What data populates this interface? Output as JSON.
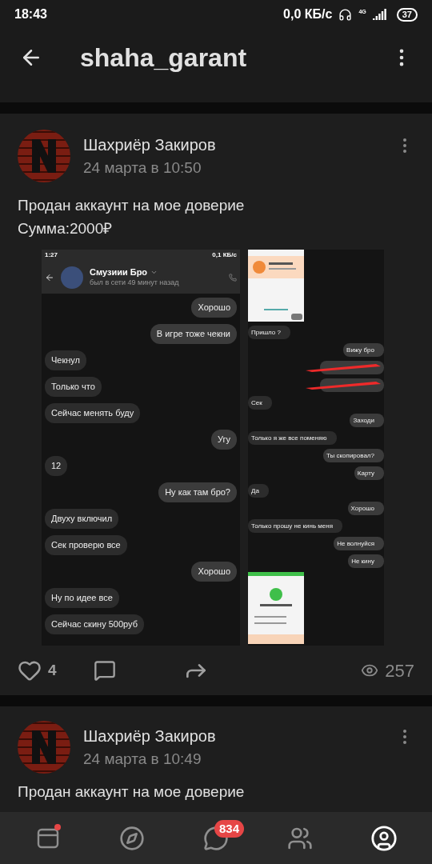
{
  "status_bar": {
    "time": "18:43",
    "speed": "0,0 КБ/с",
    "network": "4G",
    "battery": "37"
  },
  "header": {
    "title": "shaha_garant"
  },
  "posts": [
    {
      "author": "Шахриёр Закиров",
      "date": "24 марта в 10:50",
      "text": "Продан аккаунт на мое доверие\nСумма:2000₽",
      "left_chat": {
        "time": "1:27",
        "speed": "0,1 КБ/с",
        "contact": "Смузиии Бро",
        "status": "был в сети 49 минут назад",
        "messages": [
          {
            "text": "Хорошо",
            "outgoing": true
          },
          {
            "text": "В игре тоже чекни",
            "outgoing": true
          },
          {
            "text": "Чекнул",
            "outgoing": false
          },
          {
            "text": "Только что",
            "outgoing": false
          },
          {
            "text": "Сейчас менять буду",
            "outgoing": false
          },
          {
            "text": "Угу",
            "outgoing": true
          },
          {
            "text": "12",
            "outgoing": false
          },
          {
            "text": "Ну как там бро?",
            "outgoing": true
          },
          {
            "text": "Двуху включил",
            "outgoing": false
          },
          {
            "text": "Сек проверю все",
            "outgoing": false
          },
          {
            "text": "Хорошо",
            "outgoing": true
          },
          {
            "text": "Ну по идее все",
            "outgoing": false
          },
          {
            "text": "Сейчас скину 500руб",
            "outgoing": false
          }
        ]
      },
      "right_chat": {
        "items": [
          {
            "kind": "picture"
          },
          {
            "kind": "text",
            "text": "Пришло ?",
            "outgoing": false
          },
          {
            "kind": "text",
            "text": "Вижу бро",
            "outgoing": true
          },
          {
            "kind": "redacted",
            "outgoing": true
          },
          {
            "kind": "redacted",
            "outgoing": true
          },
          {
            "kind": "text",
            "text": "Сек",
            "outgoing": false
          },
          {
            "kind": "text",
            "text": "Заходи",
            "outgoing": true
          },
          {
            "kind": "text",
            "text": "Только я же все поменяю",
            "outgoing": false
          },
          {
            "kind": "text",
            "text": "Ты скопировал?",
            "outgoing": true
          },
          {
            "kind": "text",
            "text": "Карту",
            "outgoing": true
          },
          {
            "kind": "text",
            "text": "Да",
            "outgoing": false
          },
          {
            "kind": "text",
            "text": "Хорошо",
            "outgoing": true
          },
          {
            "kind": "text",
            "text": "Только прошу не кинь меня",
            "outgoing": false
          },
          {
            "kind": "text",
            "text": "Не волнуйся",
            "outgoing": true
          },
          {
            "kind": "text",
            "text": "Не кину",
            "outgoing": true
          },
          {
            "kind": "picture"
          }
        ]
      },
      "likes": "4",
      "liked": false,
      "views": "257"
    },
    {
      "author": "Шахриёр Закиров",
      "date": "24 марта в 10:49",
      "text": "Продан аккаунт на мое доверие"
    }
  ],
  "nav": [
    {
      "kind": "feed",
      "selected": false,
      "dot": true
    },
    {
      "kind": "explore",
      "selected": false,
      "dot": false
    },
    {
      "kind": "messages",
      "selected": false,
      "dot": false,
      "badge": "834"
    },
    {
      "kind": "friends",
      "selected": false,
      "dot": false
    },
    {
      "kind": "profile",
      "selected": true,
      "dot": false
    }
  ]
}
